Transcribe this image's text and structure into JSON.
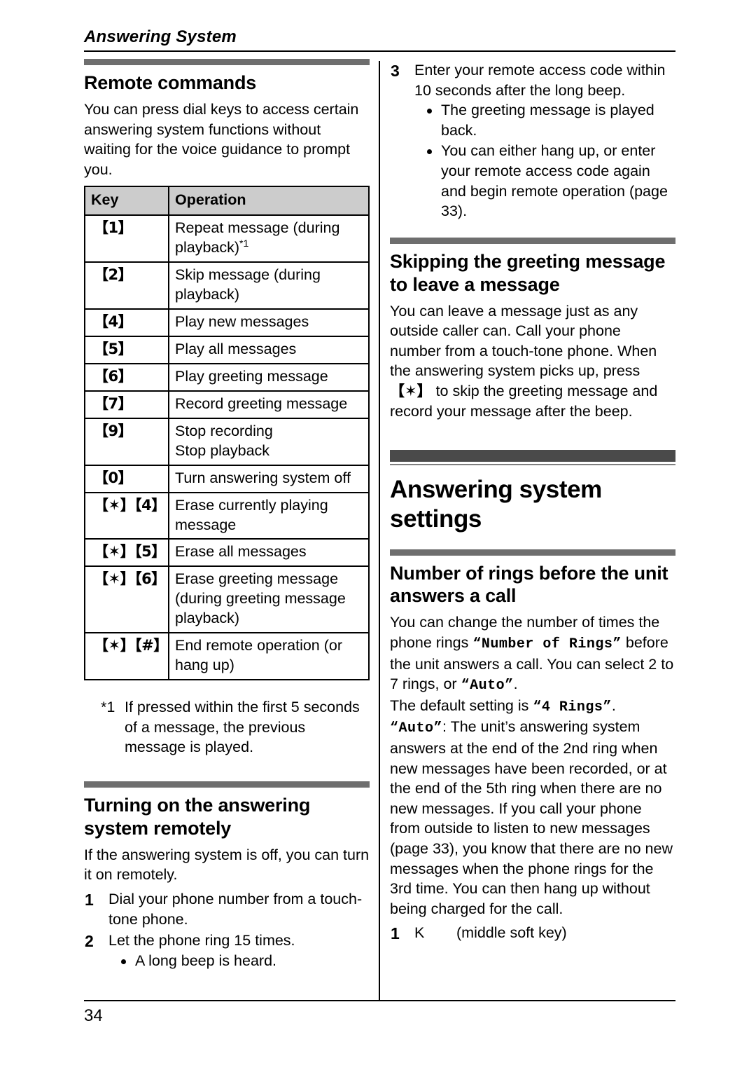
{
  "header": {
    "running_title": "Answering System"
  },
  "footer": {
    "page_number": "34"
  },
  "left_column": {
    "remote_commands": {
      "heading": "Remote commands",
      "intro": "You can press dial keys to access certain answering system functions without waiting for the voice guidance to prompt you.",
      "table": {
        "columns": [
          "Key",
          "Operation"
        ],
        "rows": [
          {
            "key": "【1】",
            "operation": "Repeat message (during playback)",
            "footnote_marker": "*1"
          },
          {
            "key": "【2】",
            "operation": "Skip message (during playback)",
            "footnote_marker": ""
          },
          {
            "key": "【4】",
            "operation": "Play new messages",
            "footnote_marker": ""
          },
          {
            "key": "【5】",
            "operation": "Play all messages",
            "footnote_marker": ""
          },
          {
            "key": "【6】",
            "operation": "Play greeting message",
            "footnote_marker": ""
          },
          {
            "key": "【7】",
            "operation": "Record greeting message",
            "footnote_marker": ""
          },
          {
            "key": "【9】",
            "operation": "Stop recording\nStop playback",
            "footnote_marker": ""
          },
          {
            "key": "【0】",
            "operation": "Turn answering system off",
            "footnote_marker": ""
          },
          {
            "key": "【✶】【4】",
            "operation": "Erase currently playing message",
            "footnote_marker": ""
          },
          {
            "key": "【✶】【5】",
            "operation": "Erase all messages",
            "footnote_marker": ""
          },
          {
            "key": "【✶】【6】",
            "operation": "Erase greeting message (during greeting message playback)",
            "footnote_marker": ""
          },
          {
            "key": "【✶】【#】",
            "operation": "End remote operation (or hang up)",
            "footnote_marker": ""
          }
        ]
      },
      "footnote": {
        "marker": "*1",
        "text": "If pressed within the first 5 seconds of a message, the previous message is played."
      }
    },
    "turning_on_remotely": {
      "heading": "Turning on the answering system remotely",
      "intro": "If the answering system is off, you can turn it on remotely.",
      "steps": [
        {
          "number": "1",
          "text": "Dial your phone number from a touch-tone phone.",
          "bullets": []
        },
        {
          "number": "2",
          "text": "Let the phone ring 15 times.",
          "bullets": [
            "A long beep is heard."
          ]
        }
      ]
    }
  },
  "right_column": {
    "continued_step": {
      "number": "3",
      "text": "Enter your remote access code within 10 seconds after the long beep.",
      "bullets": [
        "The greeting message is played back.",
        "You can either hang up, or enter your remote access code again and begin remote operation (page 33)."
      ]
    },
    "skipping_greeting": {
      "heading": "Skipping the greeting message to leave a message",
      "body_part1": "You can leave a message just as any outside caller can. Call your phone number from a touch-tone phone. When the answering system picks up, press ",
      "key_glyph": "【✶】",
      "body_part2": " to skip the greeting message and record your message after the beep."
    },
    "major_section": {
      "heading": "Answering system settings"
    },
    "number_of_rings": {
      "heading": "Number of rings before the unit answers a call",
      "para1_part1": "You can change the number of times the phone rings ",
      "para1_setting": "“Number of Rings”",
      "para1_part2": " before the unit answers a call. You can select 2 to 7 rings, or ",
      "para1_auto": "“Auto”",
      "para1_part3": ".",
      "para2_part1": "The default setting is ",
      "para2_setting": "“4 Rings”",
      "para2_part2": ".",
      "para3_auto": "“Auto”",
      "para3_text": ": The unit’s answering system answers at the end of the 2nd ring when new messages have been recorded, or at the end of the 5th ring when there are no new messages. If you call your phone from outside to listen to new messages (page 33), you know that there are no new messages when the phone rings for the 3rd time. You can then hang up without being charged for the call.",
      "step": {
        "number": "1",
        "glyph": "K",
        "text": "(middle soft key)"
      }
    }
  },
  "colors": {
    "section_bar": "#6e6e6e",
    "major_bar": "#4a4a4a",
    "table_header_bg": "#cccccc",
    "rule": "#000000"
  }
}
